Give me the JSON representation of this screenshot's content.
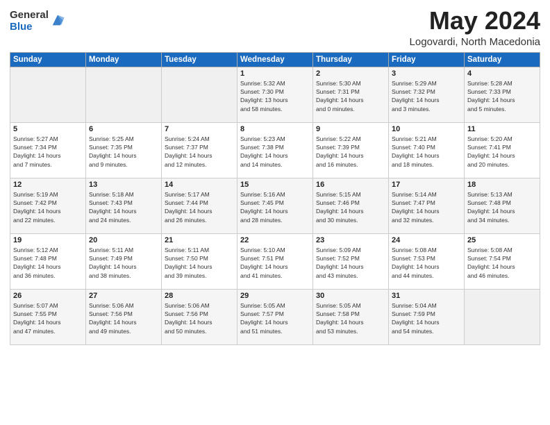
{
  "header": {
    "logo_general": "General",
    "logo_blue": "Blue",
    "title": "May 2024",
    "location": "Logovardi, North Macedonia"
  },
  "weekdays": [
    "Sunday",
    "Monday",
    "Tuesday",
    "Wednesday",
    "Thursday",
    "Friday",
    "Saturday"
  ],
  "weeks": [
    [
      {
        "day": "",
        "info": ""
      },
      {
        "day": "",
        "info": ""
      },
      {
        "day": "",
        "info": ""
      },
      {
        "day": "1",
        "info": "Sunrise: 5:32 AM\nSunset: 7:30 PM\nDaylight: 13 hours\nand 58 minutes."
      },
      {
        "day": "2",
        "info": "Sunrise: 5:30 AM\nSunset: 7:31 PM\nDaylight: 14 hours\nand 0 minutes."
      },
      {
        "day": "3",
        "info": "Sunrise: 5:29 AM\nSunset: 7:32 PM\nDaylight: 14 hours\nand 3 minutes."
      },
      {
        "day": "4",
        "info": "Sunrise: 5:28 AM\nSunset: 7:33 PM\nDaylight: 14 hours\nand 5 minutes."
      }
    ],
    [
      {
        "day": "5",
        "info": "Sunrise: 5:27 AM\nSunset: 7:34 PM\nDaylight: 14 hours\nand 7 minutes."
      },
      {
        "day": "6",
        "info": "Sunrise: 5:25 AM\nSunset: 7:35 PM\nDaylight: 14 hours\nand 9 minutes."
      },
      {
        "day": "7",
        "info": "Sunrise: 5:24 AM\nSunset: 7:37 PM\nDaylight: 14 hours\nand 12 minutes."
      },
      {
        "day": "8",
        "info": "Sunrise: 5:23 AM\nSunset: 7:38 PM\nDaylight: 14 hours\nand 14 minutes."
      },
      {
        "day": "9",
        "info": "Sunrise: 5:22 AM\nSunset: 7:39 PM\nDaylight: 14 hours\nand 16 minutes."
      },
      {
        "day": "10",
        "info": "Sunrise: 5:21 AM\nSunset: 7:40 PM\nDaylight: 14 hours\nand 18 minutes."
      },
      {
        "day": "11",
        "info": "Sunrise: 5:20 AM\nSunset: 7:41 PM\nDaylight: 14 hours\nand 20 minutes."
      }
    ],
    [
      {
        "day": "12",
        "info": "Sunrise: 5:19 AM\nSunset: 7:42 PM\nDaylight: 14 hours\nand 22 minutes."
      },
      {
        "day": "13",
        "info": "Sunrise: 5:18 AM\nSunset: 7:43 PM\nDaylight: 14 hours\nand 24 minutes."
      },
      {
        "day": "14",
        "info": "Sunrise: 5:17 AM\nSunset: 7:44 PM\nDaylight: 14 hours\nand 26 minutes."
      },
      {
        "day": "15",
        "info": "Sunrise: 5:16 AM\nSunset: 7:45 PM\nDaylight: 14 hours\nand 28 minutes."
      },
      {
        "day": "16",
        "info": "Sunrise: 5:15 AM\nSunset: 7:46 PM\nDaylight: 14 hours\nand 30 minutes."
      },
      {
        "day": "17",
        "info": "Sunrise: 5:14 AM\nSunset: 7:47 PM\nDaylight: 14 hours\nand 32 minutes."
      },
      {
        "day": "18",
        "info": "Sunrise: 5:13 AM\nSunset: 7:48 PM\nDaylight: 14 hours\nand 34 minutes."
      }
    ],
    [
      {
        "day": "19",
        "info": "Sunrise: 5:12 AM\nSunset: 7:48 PM\nDaylight: 14 hours\nand 36 minutes."
      },
      {
        "day": "20",
        "info": "Sunrise: 5:11 AM\nSunset: 7:49 PM\nDaylight: 14 hours\nand 38 minutes."
      },
      {
        "day": "21",
        "info": "Sunrise: 5:11 AM\nSunset: 7:50 PM\nDaylight: 14 hours\nand 39 minutes."
      },
      {
        "day": "22",
        "info": "Sunrise: 5:10 AM\nSunset: 7:51 PM\nDaylight: 14 hours\nand 41 minutes."
      },
      {
        "day": "23",
        "info": "Sunrise: 5:09 AM\nSunset: 7:52 PM\nDaylight: 14 hours\nand 43 minutes."
      },
      {
        "day": "24",
        "info": "Sunrise: 5:08 AM\nSunset: 7:53 PM\nDaylight: 14 hours\nand 44 minutes."
      },
      {
        "day": "25",
        "info": "Sunrise: 5:08 AM\nSunset: 7:54 PM\nDaylight: 14 hours\nand 46 minutes."
      }
    ],
    [
      {
        "day": "26",
        "info": "Sunrise: 5:07 AM\nSunset: 7:55 PM\nDaylight: 14 hours\nand 47 minutes."
      },
      {
        "day": "27",
        "info": "Sunrise: 5:06 AM\nSunset: 7:56 PM\nDaylight: 14 hours\nand 49 minutes."
      },
      {
        "day": "28",
        "info": "Sunrise: 5:06 AM\nSunset: 7:56 PM\nDaylight: 14 hours\nand 50 minutes."
      },
      {
        "day": "29",
        "info": "Sunrise: 5:05 AM\nSunset: 7:57 PM\nDaylight: 14 hours\nand 51 minutes."
      },
      {
        "day": "30",
        "info": "Sunrise: 5:05 AM\nSunset: 7:58 PM\nDaylight: 14 hours\nand 53 minutes."
      },
      {
        "day": "31",
        "info": "Sunrise: 5:04 AM\nSunset: 7:59 PM\nDaylight: 14 hours\nand 54 minutes."
      },
      {
        "day": "",
        "info": ""
      }
    ]
  ]
}
